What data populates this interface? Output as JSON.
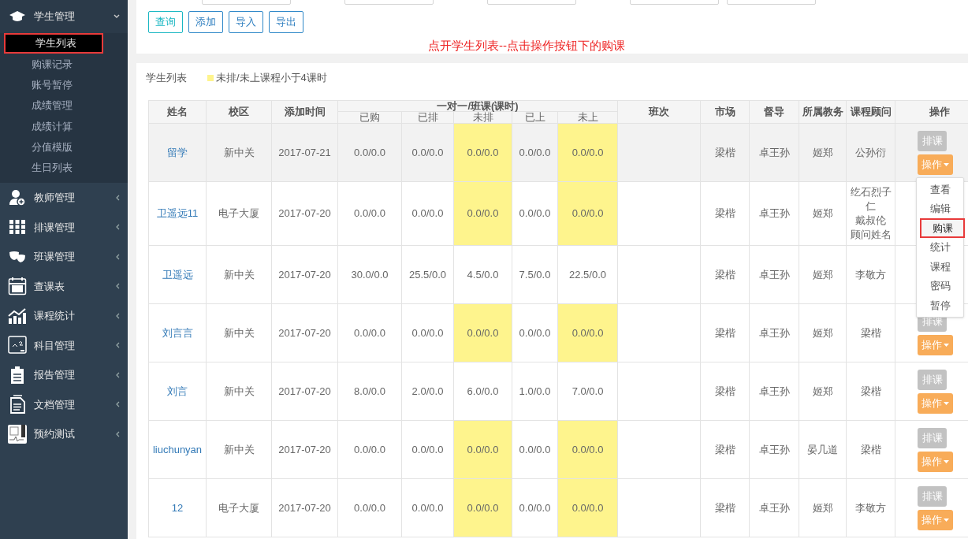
{
  "sidebar": {
    "groups": [
      {
        "label": "学生管理",
        "expanded": true,
        "children": [
          {
            "label": "学生列表",
            "selected": true,
            "annotated": true
          },
          {
            "label": "购课记录",
            "selected": false,
            "annotated": false
          },
          {
            "label": "账号暂停",
            "selected": false,
            "annotated": false
          },
          {
            "label": "成绩管理",
            "selected": false,
            "annotated": false
          },
          {
            "label": "成绩计算",
            "selected": false,
            "annotated": false
          },
          {
            "label": "分值模版",
            "selected": false,
            "annotated": false
          },
          {
            "label": "生日列表",
            "selected": false,
            "annotated": false
          }
        ]
      },
      {
        "label": "教师管理",
        "expanded": false
      },
      {
        "label": "排课管理",
        "expanded": false
      },
      {
        "label": "班课管理",
        "expanded": false
      },
      {
        "label": "查课表",
        "expanded": false
      },
      {
        "label": "课程统计",
        "expanded": false
      },
      {
        "label": "科目管理",
        "expanded": false
      },
      {
        "label": "报告管理",
        "expanded": false
      },
      {
        "label": "文档管理",
        "expanded": false
      },
      {
        "label": "预约测试",
        "expanded": false
      }
    ]
  },
  "filter_panel": {
    "buttons": [
      {
        "label": "查询",
        "kind": "primary"
      },
      {
        "label": "添加",
        "kind": "default"
      },
      {
        "label": "导入",
        "kind": "default"
      },
      {
        "label": "导出",
        "kind": "default"
      }
    ],
    "annotation": "点开学生列表--点击操作按钮下的购课"
  },
  "list_panel": {
    "title": "学生列表",
    "legend": "未排/未上课程小于4课时",
    "table": {
      "columns": [
        "姓名",
        "校区",
        "添加时间",
        "班次",
        "市场",
        "督导",
        "所属教务",
        "课程顾问",
        "操作"
      ],
      "group_header": "一对一/班课(课时)",
      "sub_columns": [
        "已购",
        "已排",
        "未排",
        "已上",
        "未上"
      ],
      "rows": [
        {
          "name": "留学",
          "campus": "新中关",
          "added": "2017-07-21",
          "hours": [
            "0.0/0.0",
            "0.0/0.0",
            "0.0/0.0",
            "0.0/0.0",
            "0.0/0.0"
          ],
          "low": true,
          "hovered": true,
          "market": "梁楷",
          "supervisor": "卓王孙",
          "academic": "姬郑",
          "advisors": [
            "公孙衍"
          ],
          "actions": [
            "排课",
            "操作"
          ]
        },
        {
          "name": "卫遥远11",
          "campus": "电子大厦",
          "added": "2017-07-20",
          "hours": [
            "0.0/0.0",
            "0.0/0.0",
            "0.0/0.0",
            "0.0/0.0",
            "0.0/0.0"
          ],
          "low": true,
          "hovered": false,
          "market": "梁楷",
          "supervisor": "卓王孙",
          "academic": "姬郑",
          "advisors": [
            "纥石烈子仁",
            "戴叔伦",
            "顾问姓名"
          ]
        },
        {
          "name": "卫遥远",
          "campus": "新中关",
          "added": "2017-07-20",
          "hours": [
            "30.0/0.0",
            "25.5/0.0",
            "4.5/0.0",
            "7.5/0.0",
            "22.5/0.0"
          ],
          "low": false,
          "hovered": false,
          "market": "梁楷",
          "supervisor": "卓王孙",
          "academic": "姬郑",
          "advisors": [
            "李敬方"
          ]
        },
        {
          "name": "刘言言",
          "campus": "新中关",
          "added": "2017-07-20",
          "hours": [
            "0.0/0.0",
            "0.0/0.0",
            "0.0/0.0",
            "0.0/0.0",
            "0.0/0.0"
          ],
          "low": true,
          "hovered": false,
          "market": "梁楷",
          "supervisor": "卓王孙",
          "academic": "姬郑",
          "advisors": [
            "梁楷"
          ],
          "actions": [
            "排课",
            "操作"
          ]
        },
        {
          "name": "刘言",
          "campus": "新中关",
          "added": "2017-07-20",
          "hours": [
            "8.0/0.0",
            "2.0/0.0",
            "6.0/0.0",
            "1.0/0.0",
            "7.0/0.0"
          ],
          "low": false,
          "hovered": false,
          "market": "梁楷",
          "supervisor": "卓王孙",
          "academic": "姬郑",
          "advisors": [
            "梁楷"
          ],
          "actions": [
            "排课",
            "操作"
          ]
        },
        {
          "name": "liuchunyan",
          "campus": "新中关",
          "added": "2017-07-20",
          "hours": [
            "0.0/0.0",
            "0.0/0.0",
            "0.0/0.0",
            "0.0/0.0",
            "0.0/0.0"
          ],
          "low": true,
          "hovered": false,
          "market": "梁楷",
          "supervisor": "卓王孙",
          "academic": "晏几道",
          "advisors": [
            "梁楷"
          ],
          "actions": [
            "排课",
            "操作"
          ]
        },
        {
          "name": "12",
          "campus": "电子大厦",
          "added": "2017-07-20",
          "hours": [
            "0.0/0.0",
            "0.0/0.0",
            "0.0/0.0",
            "0.0/0.0",
            "0.0/0.0"
          ],
          "low": true,
          "hovered": false,
          "market": "梁楷",
          "supervisor": "卓王孙",
          "academic": "姬郑",
          "advisors": [
            "李敬方"
          ],
          "actions": [
            "排课",
            "操作"
          ]
        }
      ]
    },
    "dropdown_menu": [
      {
        "label": "查看",
        "selected": false,
        "annotated": false
      },
      {
        "label": "编辑",
        "selected": false,
        "annotated": false
      },
      {
        "label": "购课",
        "selected": true,
        "annotated": true
      },
      {
        "label": "统计",
        "selected": false,
        "annotated": false
      },
      {
        "label": "课程",
        "selected": false,
        "annotated": false
      },
      {
        "label": "密码",
        "selected": false,
        "annotated": false
      },
      {
        "label": "暂停",
        "selected": false,
        "annotated": false
      }
    ]
  }
}
